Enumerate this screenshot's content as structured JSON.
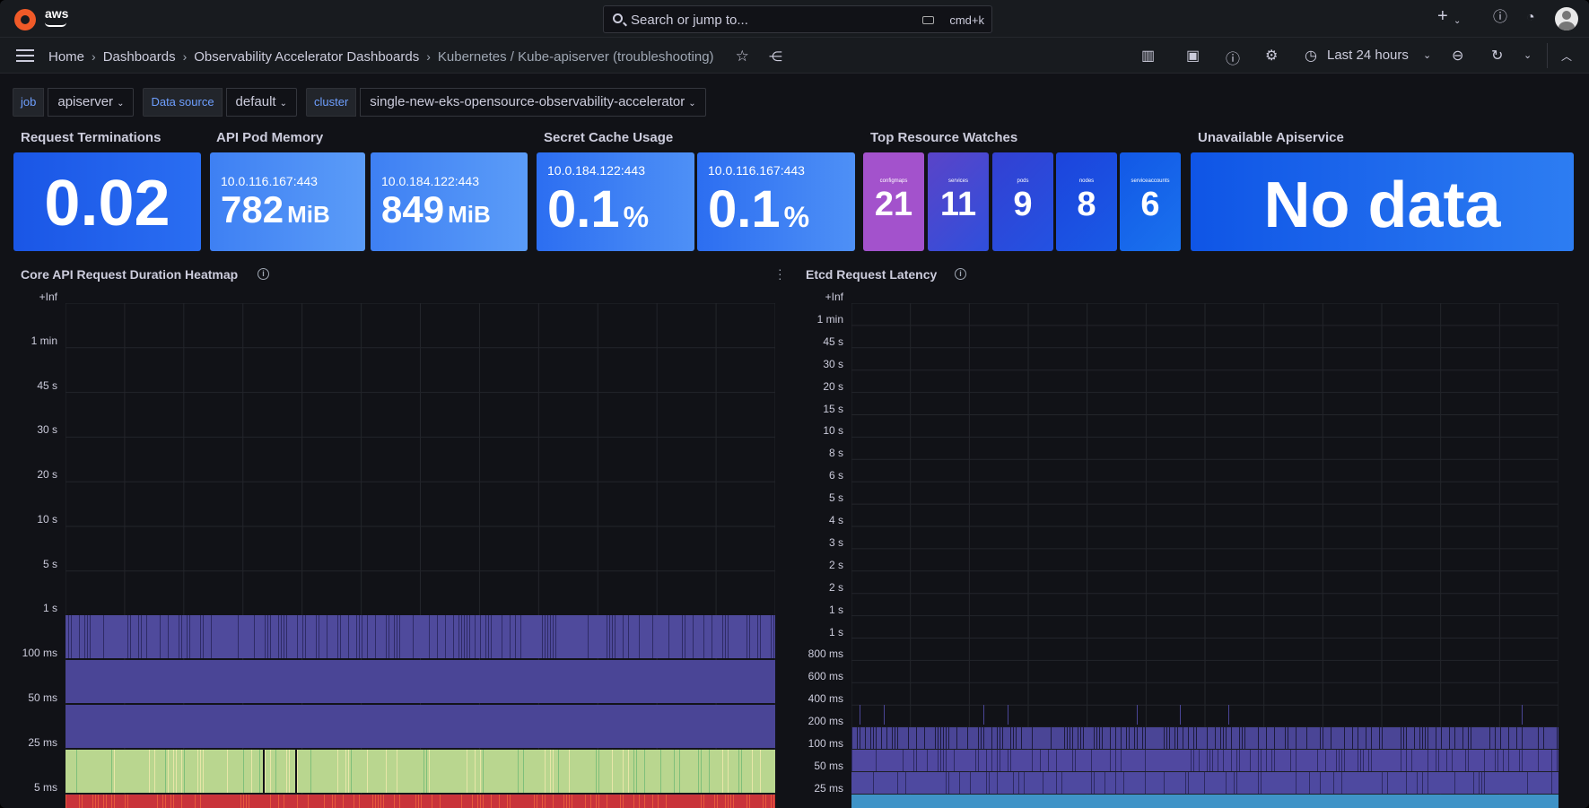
{
  "topbar": {
    "brand": "aws",
    "search_placeholder": "Search or jump to...",
    "search_shortcut": "cmd+k",
    "icons": [
      "plus-icon",
      "help-icon",
      "news-icon",
      "user-avatar"
    ]
  },
  "breadcrumb": [
    "Home",
    "Dashboards",
    "Observability Accelerator Dashboards",
    "Kubernetes / Kube-apiserver (troubleshooting)"
  ],
  "toolbar": {
    "time_range": "Last 24 hours"
  },
  "variables": [
    {
      "label": "job",
      "value": "apiserver"
    },
    {
      "label": "Data source",
      "value": "default"
    },
    {
      "label": "cluster",
      "value": "single-new-eks-opensource-observability-accelerator"
    }
  ],
  "panels": {
    "request_terminations": {
      "title": "Request Terminations",
      "value": "0.02"
    },
    "api_pod_memory": {
      "title": "API Pod Memory",
      "items": [
        {
          "instance": "10.0.116.167:443",
          "value": "782",
          "unit": "MiB"
        },
        {
          "instance": "10.0.184.122:443",
          "value": "849",
          "unit": "MiB"
        }
      ]
    },
    "secret_cache_usage": {
      "title": "Secret Cache Usage",
      "items": [
        {
          "instance": "10.0.184.122:443",
          "value": "0.1",
          "unit": "%"
        },
        {
          "instance": "10.0.116.167:443",
          "value": "0.1",
          "unit": "%"
        }
      ]
    },
    "top_resource_watches": {
      "title": "Top Resource Watches",
      "items": [
        {
          "label": "configmaps",
          "value": "21",
          "color": "#a352cc"
        },
        {
          "label": "services",
          "value": "11",
          "color": "#4054d8"
        },
        {
          "label": "pods",
          "value": "9",
          "color": "#2c46d6"
        },
        {
          "label": "nodes",
          "value": "8",
          "color": "#1a47e0"
        },
        {
          "label": "serviceaccounts",
          "value": "6",
          "color": "#1460e8"
        }
      ]
    },
    "unavailable_apiservice": {
      "title": "Unavailable Apiservice",
      "value": "No data"
    },
    "core_api_heatmap": {
      "title": "Core API Request Duration Heatmap",
      "y_ticks": [
        "+Inf",
        "1 min",
        "45 s",
        "30 s",
        "20 s",
        "10 s",
        "5 s",
        "1 s",
        "100 ms",
        "50 ms",
        "25 ms",
        "5 ms"
      ]
    },
    "etcd_latency": {
      "title": "Etcd Request Latency",
      "y_ticks": [
        "+Inf",
        "1 min",
        "45 s",
        "30 s",
        "20 s",
        "15 s",
        "10 s",
        "8 s",
        "6 s",
        "5 s",
        "4 s",
        "3 s",
        "2 s",
        "2 s",
        "1 s",
        "1 s",
        "800 ms",
        "600 ms",
        "400 ms",
        "200 ms",
        "100 ms",
        "50 ms",
        "25 ms"
      ]
    }
  },
  "colors": {
    "background": "#111217",
    "stat_blue_dark": "#1a5ce8",
    "stat_blue_light": "#4f8ff7",
    "heat_purple": "#4f4a9c",
    "heat_green": "#b8d98f",
    "heat_red": "#c9333a"
  }
}
